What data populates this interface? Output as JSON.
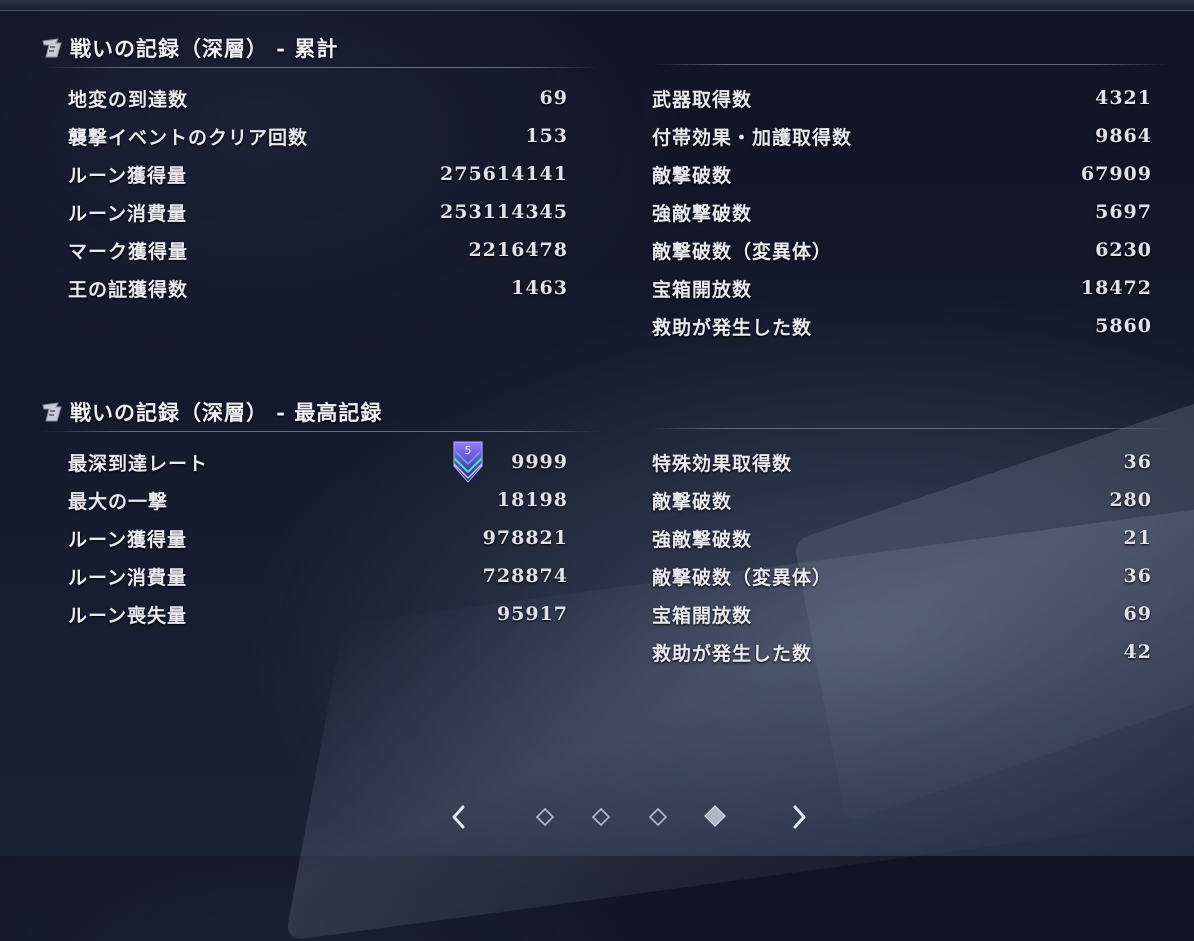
{
  "sections": [
    {
      "title": "戦いの記録（深層） - 累計",
      "left": [
        {
          "label": "地変の到達数",
          "value": "69"
        },
        {
          "label": "襲撃イベントのクリア回数",
          "value": "153"
        },
        {
          "label": "ルーン獲得量",
          "value": "275614141"
        },
        {
          "label": "ルーン消費量",
          "value": "253114345"
        },
        {
          "label": "マーク獲得量",
          "value": "2216478"
        },
        {
          "label": "王の証獲得数",
          "value": "1463"
        }
      ],
      "right": [
        {
          "label": "武器取得数",
          "value": "4321"
        },
        {
          "label": "付帯効果・加護取得数",
          "value": "9864"
        },
        {
          "label": "敵撃破数",
          "value": "67909"
        },
        {
          "label": "強敵撃破数",
          "value": "5697"
        },
        {
          "label": "敵撃破数（変異体）",
          "value": "6230"
        },
        {
          "label": "宝箱開放数",
          "value": "18472"
        },
        {
          "label": "救助が発生した数",
          "value": "5860"
        }
      ]
    },
    {
      "title": "戦いの記録（深層） - 最高記録",
      "rank_badge": "5",
      "left": [
        {
          "label": "最深到達レート",
          "value": "9999"
        },
        {
          "label": "最大の一撃",
          "value": "18198"
        },
        {
          "label": "ルーン獲得量",
          "value": "978821"
        },
        {
          "label": "ルーン消費量",
          "value": "728874"
        },
        {
          "label": "ルーン喪失量",
          "value": "95917"
        }
      ],
      "right": [
        {
          "label": "特殊効果取得数",
          "value": "36"
        },
        {
          "label": "敵撃破数",
          "value": "280"
        },
        {
          "label": "強敵撃破数",
          "value": "21"
        },
        {
          "label": "敵撃破数（変異体）",
          "value": "36"
        },
        {
          "label": "宝箱開放数",
          "value": "69"
        },
        {
          "label": "救助が発生した数",
          "value": "42"
        }
      ]
    }
  ],
  "pager": {
    "page_count": 4,
    "current_page": 4,
    "prev_icon": "chevron-left-icon",
    "next_icon": "chevron-right-icon",
    "dot_icon": "diamond-icon"
  },
  "colors": {
    "text": "#e6e8ee",
    "background": "#131a2c",
    "badge_accent": "#6a5cff"
  }
}
